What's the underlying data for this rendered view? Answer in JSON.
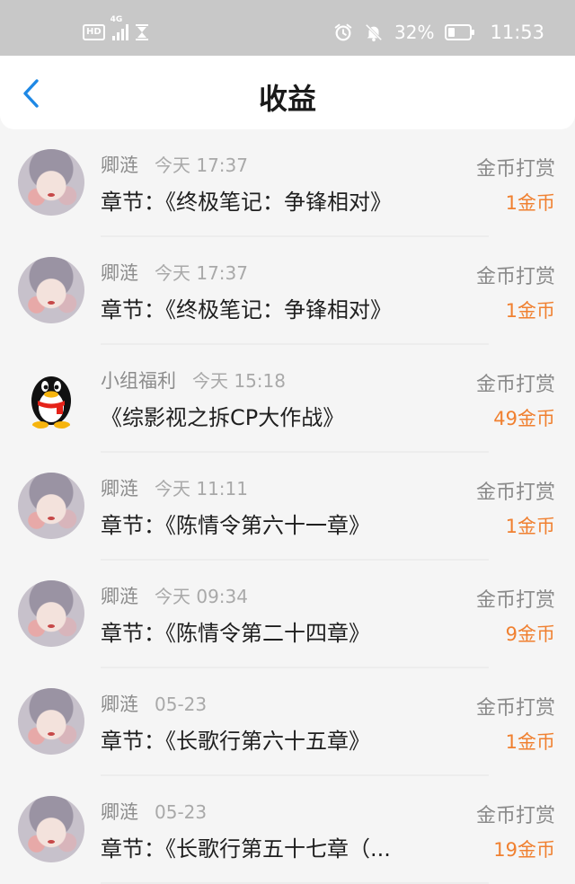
{
  "status_bar": {
    "hd_label": "HD",
    "network_label": "4G",
    "battery_percent_text": "32%",
    "battery_level": 0.32,
    "time": "11:53",
    "icons": [
      "hd-icon",
      "signal-icon",
      "hourglass-icon",
      "alarm-icon",
      "mute-icon",
      "battery-icon"
    ]
  },
  "header": {
    "back_icon": "chevron-left-icon",
    "title": "收益"
  },
  "colors": {
    "accent_blue": "#1e88e5",
    "amount_orange": "#f08030",
    "status_bar_bg": "#c8c8c8"
  },
  "records": [
    {
      "name": "卿涟",
      "time": "今天 17:37",
      "title": "章节：《终极笔记：争锋相对》",
      "type": "金币打赏",
      "amount": "1金币",
      "avatar": "girl-avatar"
    },
    {
      "name": "卿涟",
      "time": "今天 17:37",
      "title": "章节：《终极笔记：争锋相对》",
      "type": "金币打赏",
      "amount": "1金币",
      "avatar": "girl-avatar"
    },
    {
      "name": "小组福利",
      "time": "今天 15:18",
      "title": "《综影视之拆CP大作战》",
      "type": "金币打赏",
      "amount": "49金币",
      "avatar": "penguin-avatar"
    },
    {
      "name": "卿涟",
      "time": "今天 11:11",
      "title": "章节：《陈情令第六十一章》",
      "type": "金币打赏",
      "amount": "1金币",
      "avatar": "girl-avatar"
    },
    {
      "name": "卿涟",
      "time": "今天 09:34",
      "title": "章节：《陈情令第二十四章》",
      "type": "金币打赏",
      "amount": "9金币",
      "avatar": "girl-avatar"
    },
    {
      "name": "卿涟",
      "time": "05-23",
      "title": "章节：《长歌行第六十五章》",
      "type": "金币打赏",
      "amount": "1金币",
      "avatar": "girl-avatar"
    },
    {
      "name": "卿涟",
      "time": "05-23",
      "title": "章节：《长歌行第五十七章（...",
      "type": "金币打赏",
      "amount": "19金币",
      "avatar": "girl-avatar"
    }
  ]
}
